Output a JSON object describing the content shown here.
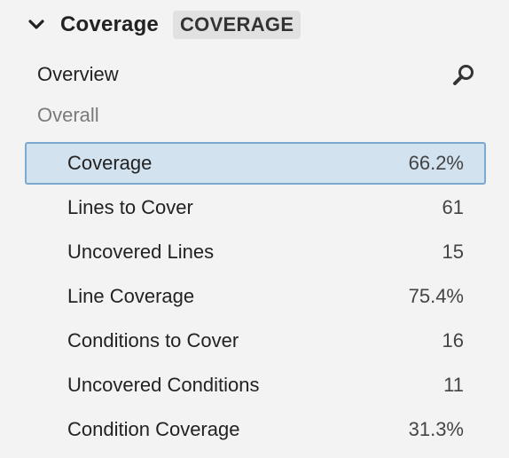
{
  "header": {
    "title": "Coverage",
    "badge": "COVERAGE"
  },
  "overview": {
    "label": "Overview"
  },
  "section": {
    "label": "Overall"
  },
  "metrics": [
    {
      "label": "Coverage",
      "value": "66.2%"
    },
    {
      "label": "Lines to Cover",
      "value": "61"
    },
    {
      "label": "Uncovered Lines",
      "value": "15"
    },
    {
      "label": "Line Coverage",
      "value": "75.4%"
    },
    {
      "label": "Conditions to Cover",
      "value": "16"
    },
    {
      "label": "Uncovered Conditions",
      "value": "11"
    },
    {
      "label": "Condition Coverage",
      "value": "31.3%"
    }
  ],
  "icons": {
    "collapse": "chevron-down-icon",
    "search": "search-icon"
  },
  "colors": {
    "background": "#f3f3f3",
    "selected_fill": "#d2e2ef",
    "selected_border": "#7da9d1",
    "badge_fill": "#e1e1e1",
    "muted_text": "#7a7a7a"
  }
}
